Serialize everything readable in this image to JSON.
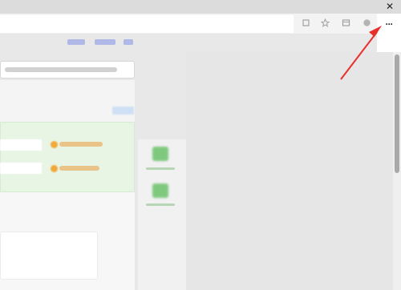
{
  "window": {
    "close_glyph": "✕"
  },
  "toolbar": {
    "more_button_label": "···",
    "icons": [
      "extension-icon",
      "favorites-icon",
      "collections-icon",
      "profile-icon"
    ]
  },
  "nav": {
    "links": [
      "",
      "",
      ""
    ]
  },
  "search": {
    "placeholder": ""
  },
  "content": {
    "tag": "",
    "links": [
      "",
      ""
    ]
  },
  "apps": [
    {
      "label": ""
    },
    {
      "label": ""
    }
  ],
  "annotation": {
    "arrow_color": "#e8302a"
  },
  "colors": {
    "accent_green": "#6cc36b",
    "accent_orange": "#f0a93a",
    "link_blue": "#5060d8"
  }
}
